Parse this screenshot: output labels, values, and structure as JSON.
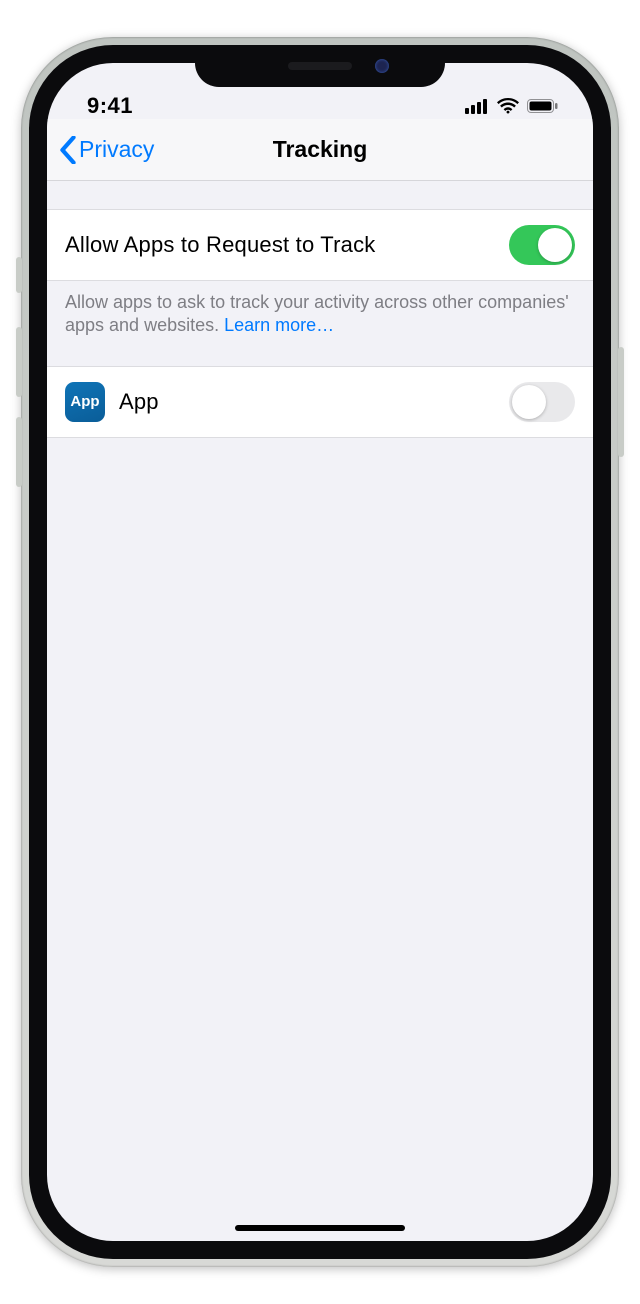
{
  "status": {
    "time": "9:41"
  },
  "nav": {
    "back_label": "Privacy",
    "title": "Tracking"
  },
  "rows": {
    "allow": {
      "label": "Allow Apps to Request to Track",
      "enabled": true
    },
    "footer_text": "Allow apps to ask to track your activity across other companies' apps and websites. ",
    "footer_link": "Learn more…",
    "app": {
      "icon_label": "App",
      "name": "App",
      "enabled": false
    }
  }
}
